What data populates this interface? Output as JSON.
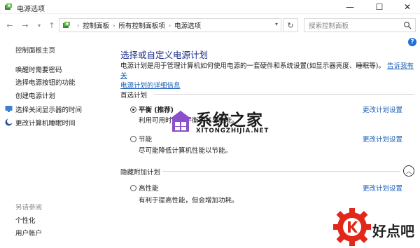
{
  "window": {
    "title": "电源选项"
  },
  "address": {
    "crumbs": [
      "控制面板",
      "所有控制面板项",
      "电源选项"
    ],
    "search_placeholder": "搜索控制面板"
  },
  "sidebar": {
    "home": "控制面板主页",
    "items": [
      "唤醒时需要密码",
      "选择电源按钮的功能",
      "创建电源计划",
      "选择关闭显示器的时间",
      "更改计算机睡眠时间"
    ],
    "see_also": "另请参阅",
    "see_also_items": [
      "个性化",
      "用户帐户"
    ]
  },
  "main": {
    "title": "选择或自定义电源计划",
    "desc_text": "电源计划是用于管理计算机如何使用电源的一套硬件和系统设置(如显示器亮度、睡眠等)。",
    "desc_link_1": "告诉我有关",
    "desc_link_2": "电源计划的详细信息",
    "preferred_label": "首选计划",
    "hidden_label": "隐藏附加计划",
    "plans": [
      {
        "name": "平衡 (推荐)",
        "desc": "利用可用时自动平衡功耗与性能。",
        "link": "更改计划设置",
        "selected": true
      },
      {
        "name": "节能",
        "desc": "尽可能降低计算机性能以节能。",
        "link": "更改计划设置",
        "selected": false
      },
      {
        "name": "高性能",
        "desc": "有利于提高性能，但会增加功耗。",
        "link": "更改计划设置",
        "selected": false
      }
    ]
  },
  "watermark": {
    "title": "系统之家",
    "sub": "XITONGZHIJIA.NET"
  },
  "corner": {
    "text": "好点吧"
  },
  "colors": {
    "link": "#1a5fb4",
    "title": "#1e3287",
    "help": "#1e6fd8",
    "accent_red": "#e0281b"
  }
}
